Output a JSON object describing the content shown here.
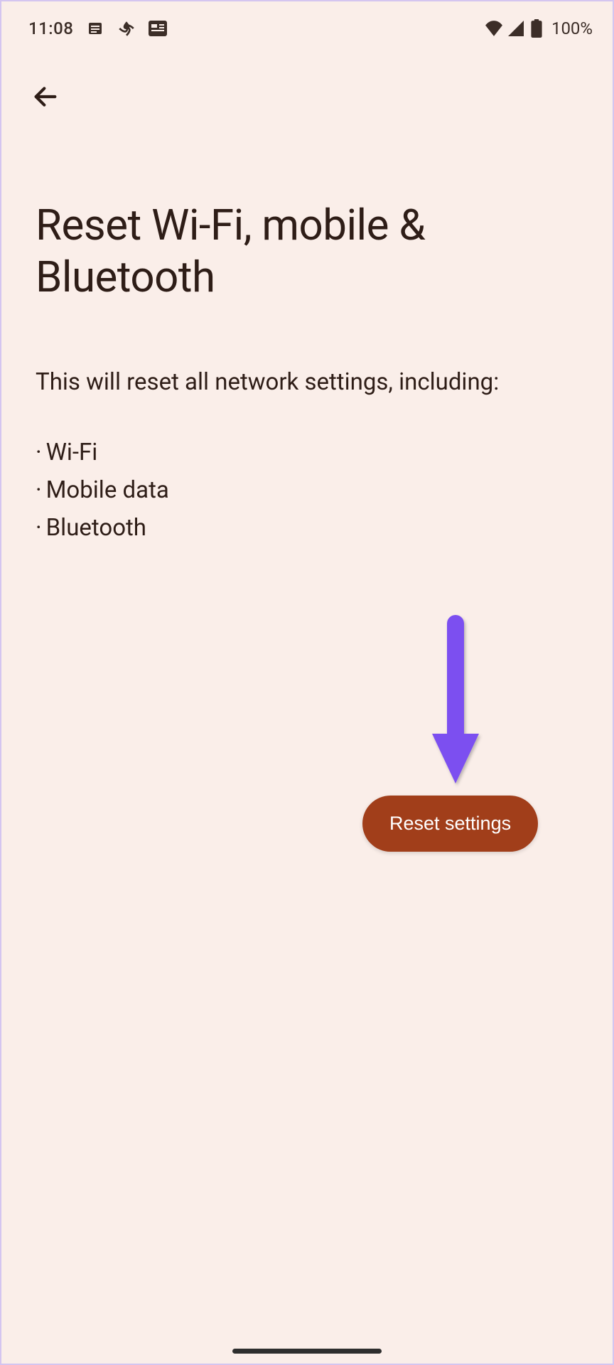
{
  "statusBar": {
    "time": "11:08",
    "batteryPercent": "100%"
  },
  "page": {
    "title": "Reset Wi-Fi, mobile & Bluetooth",
    "description": "This will reset all network settings, including:",
    "bullets": [
      "Wi-Fi",
      "Mobile data",
      "Bluetooth"
    ]
  },
  "button": {
    "resetLabel": "Reset settings"
  }
}
